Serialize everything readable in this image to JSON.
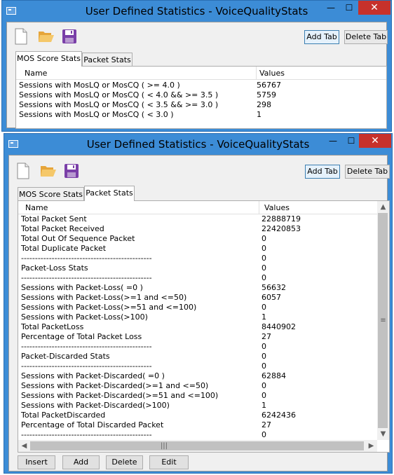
{
  "window_title": "User Defined Statistics - VoiceQualityStats",
  "window_controls": {
    "minimize": "—",
    "maximize": "☐",
    "close": "✕"
  },
  "toolbar": {
    "add_tab": "Add Tab",
    "delete_tab": "Delete Tab"
  },
  "tabs": [
    "MOS Score Stats",
    "Packet Stats"
  ],
  "columns": {
    "name": "Name",
    "values": "Values"
  },
  "mos_rows": [
    {
      "name": "Sessions with MosLQ or MosCQ ( >= 4.0 )",
      "value": "56767"
    },
    {
      "name": "Sessions with MosLQ or MosCQ ( < 4.0 && >= 3.5 )",
      "value": "5759"
    },
    {
      "name": "Sessions with MosLQ or MosCQ ( < 3.5 && >= 3.0 )",
      "value": "298"
    },
    {
      "name": "Sessions with MosLQ or MosCQ ( < 3.0 )",
      "value": "1"
    }
  ],
  "packet_rows": [
    {
      "name": "Total Packet Sent",
      "value": "22888719"
    },
    {
      "name": "Total Packet Received",
      "value": "22420853"
    },
    {
      "name": "Total Out Of Sequence Packet",
      "value": "0"
    },
    {
      "name": "Total Duplicate Packet",
      "value": "0"
    },
    {
      "name": "-----------------------------------------------",
      "value": "0"
    },
    {
      "name": "Packet-Loss Stats",
      "value": "0"
    },
    {
      "name": "-----------------------------------------------",
      "value": "0"
    },
    {
      "name": "Sessions with Packet-Loss( =0 )",
      "value": "56632"
    },
    {
      "name": "Sessions with Packet-Loss(>=1 and <=50)",
      "value": "6057"
    },
    {
      "name": "Sessions with Packet-Loss(>=51 and <=100)",
      "value": "0"
    },
    {
      "name": "Sessions with Packet-Loss(>100)",
      "value": "1"
    },
    {
      "name": "Total PacketLoss",
      "value": "8440902"
    },
    {
      "name": "Percentage of Total Packet Loss",
      "value": "27"
    },
    {
      "name": "-----------------------------------------------",
      "value": "0"
    },
    {
      "name": "Packet-Discarded Stats",
      "value": "0"
    },
    {
      "name": "-----------------------------------------------",
      "value": "0"
    },
    {
      "name": "Sessions with Packet-Discarded( =0 )",
      "value": "62884"
    },
    {
      "name": "Sessions with Packet-Discarded(>=1 and <=50)",
      "value": "0"
    },
    {
      "name": "Sessions with Packet-Discarded(>=51 and <=100)",
      "value": "0"
    },
    {
      "name": "Sessions with Packet-Discarded(>100)",
      "value": "1"
    },
    {
      "name": "Total PacketDiscarded",
      "value": "6242436"
    },
    {
      "name": "Percentage of Total Discarded Packet",
      "value": "27"
    },
    {
      "name": "-----------------------------------------------",
      "value": "0"
    }
  ],
  "bottom_buttons": {
    "insert": "Insert",
    "add": "Add",
    "delete": "Delete",
    "edit": "Edit"
  },
  "scroll_grip": "|||",
  "icons": [
    "new-file-icon",
    "open-folder-icon",
    "save-disk-icon"
  ],
  "colors": {
    "titlebar": "#3c8cd6",
    "close": "#c7312b",
    "save_icon": "#7a3fa8",
    "folder": "#f1b84a"
  }
}
